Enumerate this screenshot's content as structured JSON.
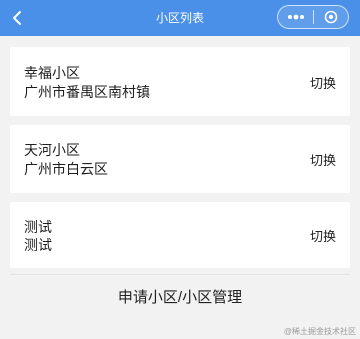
{
  "header": {
    "title": "小区列表",
    "bg_color": "#4a90e9",
    "back_icon": "chevron-left-icon",
    "more_icon": "more-dots-icon",
    "close_icon": "target-close-icon"
  },
  "communities": [
    {
      "name": "幸福小区",
      "address": "广州市番禺区南村镇",
      "action": "切换"
    },
    {
      "name": "天河小区",
      "address": "广州市白云区",
      "action": "切换"
    },
    {
      "name": "测试",
      "address": "测试",
      "action": "切换"
    }
  ],
  "bottom_button": {
    "label": "申请小区/小区管理"
  },
  "watermark": {
    "text": "@稀土掘金技术社区"
  }
}
